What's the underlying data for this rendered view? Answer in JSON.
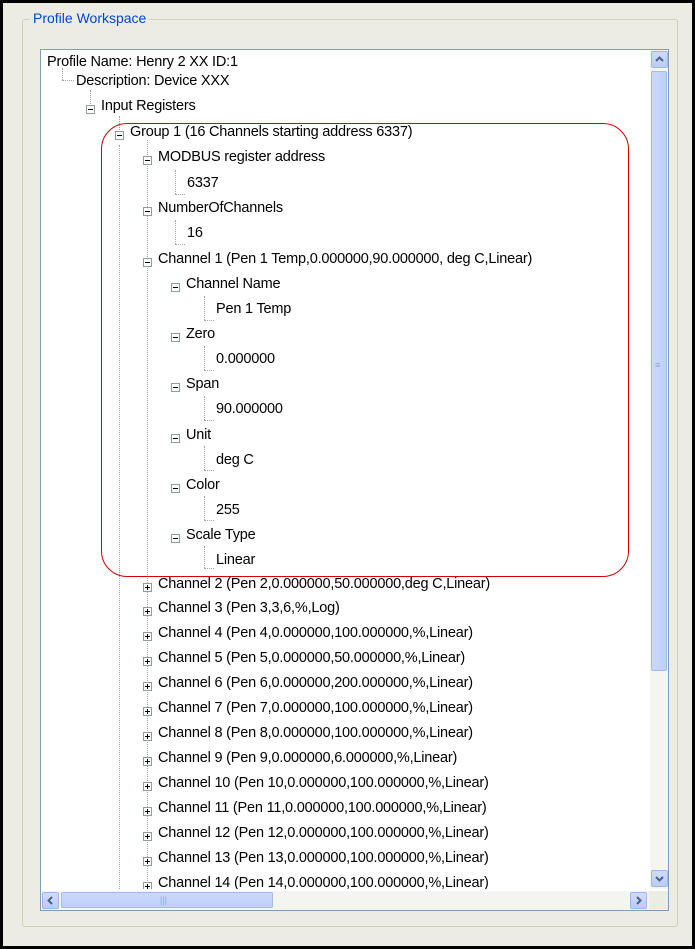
{
  "panel": {
    "title": "Profile Workspace"
  },
  "tree": {
    "root": "Profile Name: Henry 2 XX ID:1",
    "description": "Description: Device XXX",
    "input_registers": "Input Registers",
    "group1": "Group 1 (16 Channels starting address 6337)",
    "modbus": "MODBUS register address",
    "modbus_value": "6337",
    "num_channels": "NumberOfChannels",
    "num_channels_value": "16",
    "channel1": "Channel 1 (Pen 1 Temp,0.000000,90.000000, deg C,Linear)",
    "channel_name": "Channel Name",
    "channel_name_value": "Pen 1 Temp",
    "zero": "Zero",
    "zero_value": "0.000000",
    "span": "Span",
    "span_value": "90.000000",
    "unit": "Unit",
    "unit_value": "deg C",
    "color": "Color",
    "color_value": "255",
    "scale_type": "Scale Type",
    "scale_type_value": "Linear",
    "channels": [
      "Channel 2 (Pen 2,0.000000,50.000000,deg C,Linear)",
      "Channel 3 (Pen 3,3,6,%,Log)",
      "Channel 4 (Pen 4,0.000000,100.000000,%,Linear)",
      "Channel 5 (Pen 5,0.000000,50.000000,%,Linear)",
      "Channel 6 (Pen 6,0.000000,200.000000,%,Linear)",
      "Channel 7 (Pen 7,0.000000,100.000000,%,Linear)",
      "Channel 8 (Pen 8,0.000000,100.000000,%,Linear)",
      "Channel 9 (Pen 9,0.000000,6.000000,%,Linear)",
      "Channel 10 (Pen 10,0.000000,100.000000,%,Linear)",
      "Channel 11 (Pen 11,0.000000,100.000000,%,Linear)",
      "Channel 12 (Pen 12,0.000000,100.000000,%,Linear)",
      "Channel 13 (Pen 13,0.000000,100.000000,%,Linear)",
      "Channel 14 (Pen 14,0.000000,100.000000,%,Linear)"
    ]
  },
  "scrollbars": {
    "up_icon": "chevron-up-icon",
    "down_icon": "chevron-down-icon",
    "left_icon": "chevron-left-icon",
    "right_icon": "chevron-right-icon"
  },
  "colors": {
    "title": "#0046d5",
    "highlight": "#d30000",
    "scroll_thumb": "#c3d3fa"
  }
}
